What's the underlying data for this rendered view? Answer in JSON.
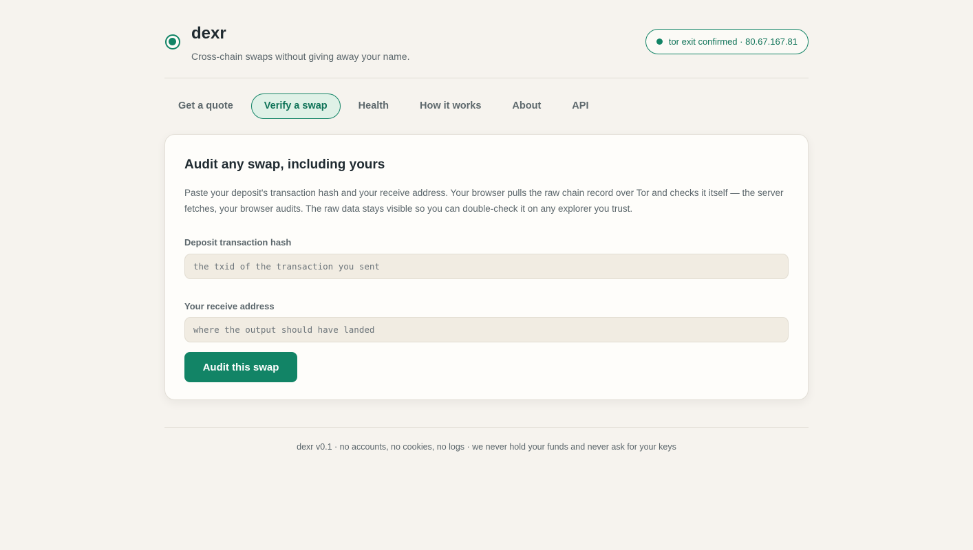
{
  "header": {
    "brand": "dexr",
    "tagline": "Cross-chain swaps without giving away your name.",
    "tor_status": "tor exit confirmed · 80.67.167.81"
  },
  "tabs": [
    {
      "label": "Get a quote",
      "active": false
    },
    {
      "label": "Verify a swap",
      "active": true
    },
    {
      "label": "Health",
      "active": false
    },
    {
      "label": "How it works",
      "active": false
    },
    {
      "label": "About",
      "active": false
    },
    {
      "label": "API",
      "active": false
    }
  ],
  "audit": {
    "title": "Audit any swap, including yours",
    "description": "Paste your deposit's transaction hash and your receive address. Your browser pulls the raw chain record over Tor and checks it itself — the server fetches, your browser audits. The raw data stays visible so you can double-check it on any explorer you trust.",
    "tx_label": "Deposit transaction hash",
    "tx_value": "",
    "tx_placeholder": "the txid of the transaction you sent",
    "addr_label": "Your receive address",
    "addr_value": "",
    "addr_placeholder": "where the output should have landed",
    "button": "Audit this swap"
  },
  "footer": {
    "text": "dexr v0.1 · no accounts, no cookies, no logs · we never hold your funds and never ask for your keys"
  },
  "colors": {
    "accent": "#128466",
    "background": "#f6f3ee",
    "card": "#fefdfa"
  }
}
